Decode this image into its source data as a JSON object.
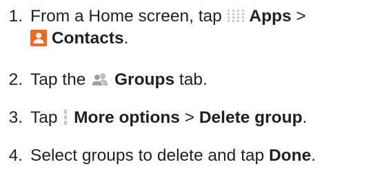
{
  "steps": [
    {
      "number": "1.",
      "line1_text": "From a Home screen, tap ",
      "apps_label": "Apps",
      "separator": " >",
      "contacts_label": "Contacts",
      "end": ".",
      "icons": [
        "apps-icon",
        "contacts-icon"
      ]
    },
    {
      "number": "2.",
      "text_before": "Tap the ",
      "groups_label": "Groups",
      "text_after": " tab.",
      "icons": [
        "groups-icon"
      ]
    },
    {
      "number": "3.",
      "text_before": "Tap ",
      "more_options_label": "More options",
      "separator": " > ",
      "delete_group_label": "Delete group",
      "end": ".",
      "icons": [
        "more-options-icon"
      ]
    },
    {
      "number": "4.",
      "text_before": "Select groups to delete and tap ",
      "done_label": "Done",
      "end": "."
    }
  ],
  "colors": {
    "text": "#231f20",
    "contacts_icon": "#f26522",
    "icon_gray": "#c8c8c8"
  }
}
